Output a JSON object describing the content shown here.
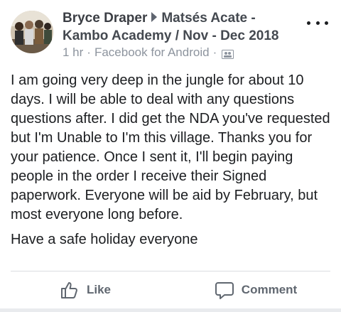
{
  "post": {
    "author": "Bryce Draper",
    "group": "Matsés Acate - Kambo Academy / Nov - Dec 2018",
    "time": "1 hr",
    "separator": "·",
    "source": "Facebook for Android",
    "audience_icon": "group-audience-icon",
    "paragraphs": [
      "I am going very deep in the jungle for about 10 days. I will be able to deal with any questions questions after. I did get the NDA you've requested but I'm Unable to I'm this village. Thanks you for your patience. Once I sent it, I'll begin paying people in the order I receive their Signed paperwork. Everyone will be aid by February, but most everyone long before.",
      "Have a safe holiday everyone"
    ]
  },
  "actions": {
    "like_label": "Like",
    "comment_label": "Comment"
  },
  "colors": {
    "text": "#1c1e21",
    "meta": "#8d949e",
    "action": "#606770",
    "divider": "#dadde1"
  }
}
